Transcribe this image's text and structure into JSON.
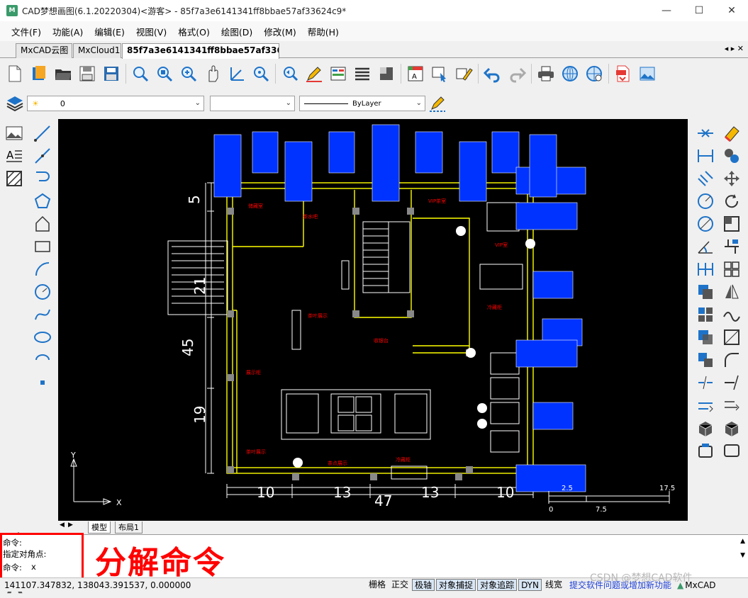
{
  "window": {
    "title": "CAD梦想画图(6.1.20220304)<游客> - 85f7a3e6141341ff8bbae57af33624c9*",
    "minimize": "—",
    "maximize": "☐",
    "close": "✕"
  },
  "menu": [
    "文件(F)",
    "功能(A)",
    "编辑(E)",
    "视图(V)",
    "格式(O)",
    "绘图(D)",
    "修改(M)",
    "帮助(H)"
  ],
  "tabs": [
    "MxCAD云图",
    "MxCloud1",
    "85f7a3e6141341ff8bbae57af3362..."
  ],
  "tab_nav": "◂ ▸ ✕",
  "layer_bar": {
    "layer_value": "0",
    "color_value": "",
    "linetype_value": "ByLayer"
  },
  "canvas": {
    "bg": "#000000",
    "dims": {
      "top": "5",
      "left_upper": "21",
      "left_mid": "45",
      "left_lower": "19",
      "bottom_1": "10",
      "bottom_2": "13",
      "bottom_3": "13",
      "bottom_4": "10",
      "bottom_total": "47"
    },
    "scale": {
      "s1": "2.5",
      "s2": "17.5",
      "s3": "0",
      "s4": "7.5"
    },
    "ucs": {
      "y": "Y",
      "x": "X"
    },
    "labels": [
      "VIP茶室",
      "收银台",
      "茶叶展示",
      "展示柜",
      "VIP室",
      "冷藏柜",
      "茶点展示",
      "茶叶展示",
      "储藏室",
      "茶水吧",
      "冷藏柜"
    ]
  },
  "layout_tabs": [
    "模型",
    "布局1"
  ],
  "command": {
    "line1": "命令:",
    "line2": "  指定对角点:",
    "prompt": "命令:",
    "input": "x"
  },
  "annotation": "分解命令",
  "status": {
    "coords": "141107.347832,  138043.391537,  0.000000",
    "buttons": [
      "栅格",
      "正交",
      "极轴",
      "对象捕捉",
      "对象追踪",
      "DYN",
      "线宽"
    ],
    "link": "提交软件问题或增加新功能",
    "brand": "MxCAD"
  },
  "watermark": "CSDN @梦想CAD软件",
  "colors": {
    "accent_blue": "#0033ff",
    "wall_yellow": "#ffff00",
    "label_red": "#ff0000",
    "highlight_red": "#ff0000"
  }
}
